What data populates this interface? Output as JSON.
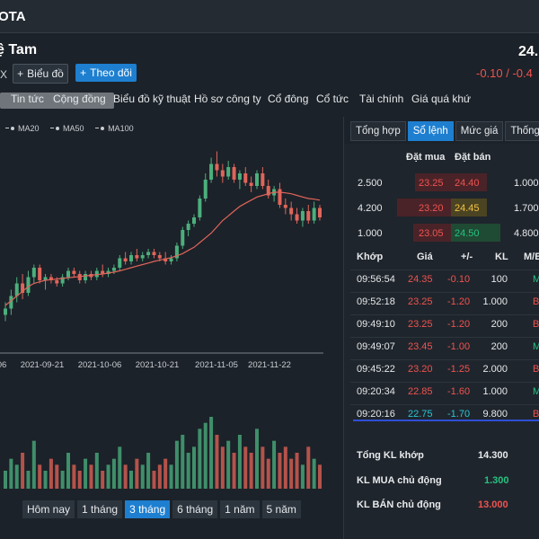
{
  "header": {
    "ticker": "OTA",
    "company": "ệ Tam",
    "exchange": "X",
    "price": "24.",
    "change": "-0.10 / -0.4"
  },
  "buttons": {
    "chart": "Biểu đồ",
    "follow": "Theo dõi"
  },
  "nav": [
    "Tin tức",
    "Cộng đồng",
    "Biểu đồ kỹ thuật",
    "Hồ sơ công ty",
    "Cổ đông",
    "Cổ tức",
    "Tài chính",
    "Giá quá khứ"
  ],
  "legend": [
    "MA20",
    "MA50",
    "MA100"
  ],
  "ranges": [
    {
      "label": "Hôm nay",
      "active": false
    },
    {
      "label": "1 tháng",
      "active": false
    },
    {
      "label": "3 tháng",
      "active": true
    },
    {
      "label": "6 tháng",
      "active": false
    },
    {
      "label": "1 năm",
      "active": false
    },
    {
      "label": "5 năm",
      "active": false
    }
  ],
  "tabs": [
    {
      "label": "Tổng hợp",
      "active": false
    },
    {
      "label": "Sổ lệnh",
      "active": true
    },
    {
      "label": "Mức giá",
      "active": false
    },
    {
      "label": "Thống kê",
      "active": false
    }
  ],
  "orderbook": {
    "headers": {
      "bid": "Đặt mua",
      "ask": "Đặt bán"
    },
    "rows": [
      {
        "bid_vol": "2.500",
        "bid": "23.25",
        "ask": "24.40",
        "ask_vol": "1.000"
      },
      {
        "bid_vol": "4.200",
        "bid": "23.20",
        "ask": "24.45",
        "ask_vol": "1.700"
      },
      {
        "bid_vol": "1.000",
        "bid": "23.05",
        "ask": "24.50",
        "ask_vol": "4.800"
      }
    ]
  },
  "trades": {
    "headers": {
      "time": "Khớp",
      "price": "Giá",
      "change": "+/-",
      "vol": "KL",
      "side": "M/B"
    },
    "rows": [
      {
        "time": "09:56:54",
        "price": "24.35",
        "change": "-0.10",
        "vol": "100",
        "side": "M"
      },
      {
        "time": "09:52:18",
        "price": "23.25",
        "change": "-1.20",
        "vol": "1.000",
        "side": "B"
      },
      {
        "time": "09:49:10",
        "price": "23.25",
        "change": "-1.20",
        "vol": "200",
        "side": "B"
      },
      {
        "time": "09:49:07",
        "price": "23.45",
        "change": "-1.00",
        "vol": "200",
        "side": "M"
      },
      {
        "time": "09:45:22",
        "price": "23.20",
        "change": "-1.25",
        "vol": "2.000",
        "side": "B"
      },
      {
        "time": "09:20:34",
        "price": "22.85",
        "change": "-1.60",
        "vol": "1.000",
        "side": "M"
      },
      {
        "time": "09:20:16",
        "price": "22.75",
        "change": "-1.70",
        "vol": "9.800",
        "side": "B"
      }
    ]
  },
  "summary": [
    {
      "label": "Tổng KL khớp",
      "value": "14.300",
      "color": "white"
    },
    {
      "label": "KL MUA chủ động",
      "value": "1.300",
      "color": "green"
    },
    {
      "label": "KL BÁN chủ động",
      "value": "13.000",
      "color": "red"
    }
  ],
  "chart_data": {
    "type": "candlestick",
    "x_tick_labels": [
      "06",
      "2021-09-21",
      "2021-10-06",
      "2021-10-21",
      "2021-11-05",
      "2021-11-22"
    ],
    "ylim": [
      19.5,
      25.5
    ],
    "colors": {
      "up": "#4caf7d",
      "down": "#e0655a",
      "ma": "#e0655a"
    },
    "candles": [
      [
        20.0,
        20.4,
        19.8,
        20.2
      ],
      [
        20.2,
        20.8,
        20.0,
        20.6
      ],
      [
        20.6,
        21.2,
        20.4,
        21.0
      ],
      [
        21.0,
        21.3,
        20.5,
        20.7
      ],
      [
        20.7,
        21.4,
        20.6,
        21.2
      ],
      [
        21.2,
        21.6,
        21.0,
        21.5
      ],
      [
        21.5,
        21.6,
        21.0,
        21.1
      ],
      [
        21.1,
        21.3,
        20.8,
        21.2
      ],
      [
        21.2,
        21.3,
        21.0,
        21.1
      ],
      [
        21.1,
        21.2,
        20.9,
        21.0
      ],
      [
        21.0,
        21.3,
        20.9,
        21.2
      ],
      [
        21.2,
        21.5,
        21.1,
        21.4
      ],
      [
        21.4,
        21.5,
        21.2,
        21.3
      ],
      [
        21.3,
        21.4,
        21.0,
        21.1
      ],
      [
        21.1,
        21.4,
        21.0,
        21.3
      ],
      [
        21.3,
        21.4,
        21.1,
        21.2
      ],
      [
        21.2,
        21.5,
        21.1,
        21.4
      ],
      [
        21.4,
        21.6,
        21.2,
        21.3
      ],
      [
        21.3,
        21.5,
        21.2,
        21.4
      ],
      [
        21.4,
        21.6,
        21.3,
        21.5
      ],
      [
        21.5,
        21.9,
        21.4,
        21.8
      ],
      [
        21.8,
        22.0,
        21.6,
        21.7
      ],
      [
        21.7,
        22.0,
        21.6,
        21.9
      ],
      [
        21.9,
        22.1,
        21.7,
        21.8
      ],
      [
        21.8,
        22.0,
        21.7,
        21.9
      ],
      [
        21.9,
        22.1,
        21.8,
        22.0
      ],
      [
        22.0,
        22.1,
        21.8,
        21.9
      ],
      [
        21.9,
        22.0,
        21.7,
        21.8
      ],
      [
        21.8,
        22.0,
        21.6,
        21.7
      ],
      [
        21.7,
        21.9,
        21.6,
        21.8
      ],
      [
        21.8,
        22.3,
        21.7,
        22.2
      ],
      [
        22.2,
        22.8,
        22.1,
        22.7
      ],
      [
        22.7,
        23.0,
        22.5,
        22.9
      ],
      [
        22.9,
        23.2,
        22.8,
        23.1
      ],
      [
        23.1,
        23.8,
        23.0,
        23.7
      ],
      [
        23.7,
        24.5,
        23.6,
        24.3
      ],
      [
        24.3,
        25.0,
        24.2,
        24.8
      ],
      [
        24.8,
        25.2,
        24.4,
        24.6
      ],
      [
        24.6,
        24.8,
        24.2,
        24.4
      ],
      [
        24.4,
        24.9,
        24.3,
        24.7
      ],
      [
        24.7,
        24.8,
        24.2,
        24.3
      ],
      [
        24.3,
        24.6,
        24.0,
        24.5
      ],
      [
        24.5,
        24.7,
        24.1,
        24.2
      ],
      [
        24.2,
        24.4,
        23.9,
        24.1
      ],
      [
        24.1,
        24.6,
        24.0,
        24.5
      ],
      [
        24.5,
        24.7,
        24.0,
        24.1
      ],
      [
        24.1,
        24.3,
        23.7,
        23.8
      ],
      [
        23.8,
        24.1,
        23.6,
        24.0
      ],
      [
        24.0,
        24.2,
        23.4,
        23.5
      ],
      [
        23.5,
        23.7,
        23.2,
        23.4
      ],
      [
        23.4,
        23.6,
        23.0,
        23.2
      ],
      [
        23.2,
        23.4,
        22.9,
        23.0
      ],
      [
        23.0,
        23.4,
        22.8,
        23.3
      ],
      [
        23.3,
        23.5,
        22.9,
        23.0
      ],
      [
        23.0,
        23.6,
        22.9,
        23.4
      ],
      [
        23.4,
        23.5,
        23.0,
        23.1
      ]
    ],
    "ma": [
      20.3,
      20.45,
      20.6,
      20.75,
      20.9,
      21.0,
      21.05,
      21.1,
      21.12,
      21.14,
      21.16,
      21.18,
      21.2,
      21.22,
      21.24,
      21.26,
      21.28,
      21.3,
      21.33,
      21.36,
      21.4,
      21.45,
      21.5,
      21.55,
      21.6,
      21.65,
      21.7,
      21.74,
      21.78,
      21.82,
      21.88,
      21.95,
      22.05,
      22.15,
      22.3,
      22.45,
      22.6,
      22.8,
      23.0,
      23.15,
      23.3,
      23.45,
      23.55,
      23.65,
      23.75,
      23.8,
      23.85,
      23.9,
      23.9,
      23.88,
      23.85,
      23.8,
      23.75,
      23.7,
      23.68,
      23.65
    ],
    "volume": [
      3,
      5,
      4,
      6,
      3,
      8,
      4,
      3,
      5,
      4,
      3,
      6,
      4,
      3,
      5,
      4,
      6,
      3,
      4,
      5,
      7,
      4,
      3,
      5,
      4,
      6,
      3,
      4,
      5,
      4,
      8,
      9,
      6,
      7,
      10,
      11,
      12,
      9,
      7,
      8,
      6,
      9,
      7,
      6,
      10,
      7,
      5,
      8,
      6,
      7,
      5,
      6,
      4,
      7,
      5,
      4
    ]
  }
}
